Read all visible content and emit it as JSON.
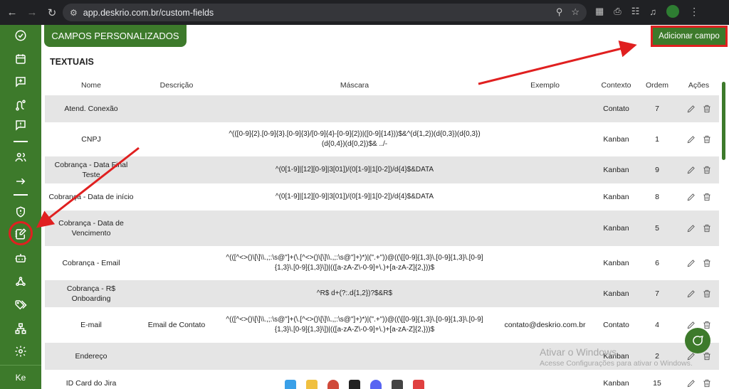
{
  "browser": {
    "url": "app.deskrio.com.br/custom-fields",
    "back_icon": "arrow-left-icon",
    "forward_icon": "arrow-right-icon",
    "reload_icon": "reload-icon"
  },
  "sidebar": {
    "items": [
      {
        "icon": "check-circle-icon"
      },
      {
        "icon": "calendar-icon"
      },
      {
        "icon": "message-plus-icon"
      },
      {
        "icon": "route-icon"
      },
      {
        "icon": "message-alert-icon"
      },
      {
        "icon": "users-icon"
      },
      {
        "icon": "arrow-right-icon"
      },
      {
        "icon": "shield-alert-icon"
      },
      {
        "icon": "notebook-pen-icon"
      },
      {
        "icon": "bot-icon"
      },
      {
        "icon": "webhook-icon"
      },
      {
        "icon": "tags-icon"
      },
      {
        "icon": "network-icon"
      },
      {
        "icon": "settings-icon"
      }
    ],
    "user_initials": "Ke"
  },
  "page": {
    "title": "CAMPOS PERSONALIZADOS",
    "add_button_label": "Adicionar campo",
    "section_title": "TEXTUAIS"
  },
  "table": {
    "headers": {
      "name": "Nome",
      "description": "Descrição",
      "mask": "Máscara",
      "example": "Exemplo",
      "context": "Contexto",
      "order": "Ordem",
      "actions": "Ações"
    },
    "rows": [
      {
        "name": "Atend. Conexão",
        "description": "",
        "mask": "",
        "example": "",
        "context": "Contato",
        "order": "7"
      },
      {
        "name": "CNPJ",
        "description": "",
        "mask": "^(([0-9]{2}.[0-9]{3}.[0-9]{3}/[0-9]{4}-[0-9]{2})|([0-9]{14}))$&^(d{1,2})(d{0,3})(d{0,3})(d{0,4})(d{0,2})$& ../-",
        "example": "",
        "context": "Kanban",
        "order": "1"
      },
      {
        "name": "Cobrança - Data Final Teste",
        "description": "",
        "mask": "^(0[1-9]|[12][0-9]|3[01])/(0[1-9]|1[0-2])/d{4}$&DATA",
        "example": "",
        "context": "Kanban",
        "order": "9"
      },
      {
        "name": "Cobrança - Data de início",
        "description": "",
        "mask": "^(0[1-9]|[12][0-9]|3[01])/(0[1-9]|1[0-2])/d{4}$&DATA",
        "example": "",
        "context": "Kanban",
        "order": "8"
      },
      {
        "name": "Cobrança - Data de Vencimento",
        "description": "",
        "mask": "",
        "example": "",
        "context": "Kanban",
        "order": "5"
      },
      {
        "name": "Cobrança - Email",
        "description": "",
        "mask": "^(([^<>()\\[\\]\\\\.,;:\\s@\"]+(\\.[^<>()\\[\\]\\\\.,;:\\s@\"]+)*)|(\".+\"))@((\\[[0-9]{1,3}\\.[0-9]{1,3}\\.[0-9]{1,3}\\.[0-9]{1,3}\\])|(([a-zA-Z\\-0-9]+\\.)+[a-zA-Z]{2,}))$",
        "example": "",
        "context": "Kanban",
        "order": "6"
      },
      {
        "name": "Cobrança - R$ Onboarding",
        "description": "",
        "mask": "^R$ d+(?:.d{1,2})?$&R$",
        "example": "",
        "context": "Kanban",
        "order": "7"
      },
      {
        "name": "E-mail",
        "description": "Email de Contato",
        "mask": "^(([^<>()\\[\\]\\\\.,;:\\s@\"]+(\\.[^<>()\\[\\]\\\\.,;:\\s@\"]+)*)|(\".+\"))@((\\[[0-9]{1,3}\\.[0-9]{1,3}\\.[0-9]{1,3}\\.[0-9]{1,3}\\])|(([a-zA-Z\\-0-9]+\\.)+[a-zA-Z]{2,}))$",
        "example": "contato@deskrio.com.br",
        "context": "Contato",
        "order": "4"
      },
      {
        "name": "Endereço",
        "description": "",
        "mask": "",
        "example": "",
        "context": "Kanban",
        "order": "2"
      },
      {
        "name": "ID Card do Jira",
        "description": "",
        "mask": "",
        "example": "",
        "context": "Kanban",
        "order": "15"
      }
    ]
  },
  "watermark": {
    "line1": "Ativar o Windows",
    "line2": "Acesse Configurações para ativar o Windows."
  },
  "colors": {
    "brand_green": "#3d7a2b",
    "highlight_red": "#e02020",
    "row_gray": "#e5e5e5"
  }
}
